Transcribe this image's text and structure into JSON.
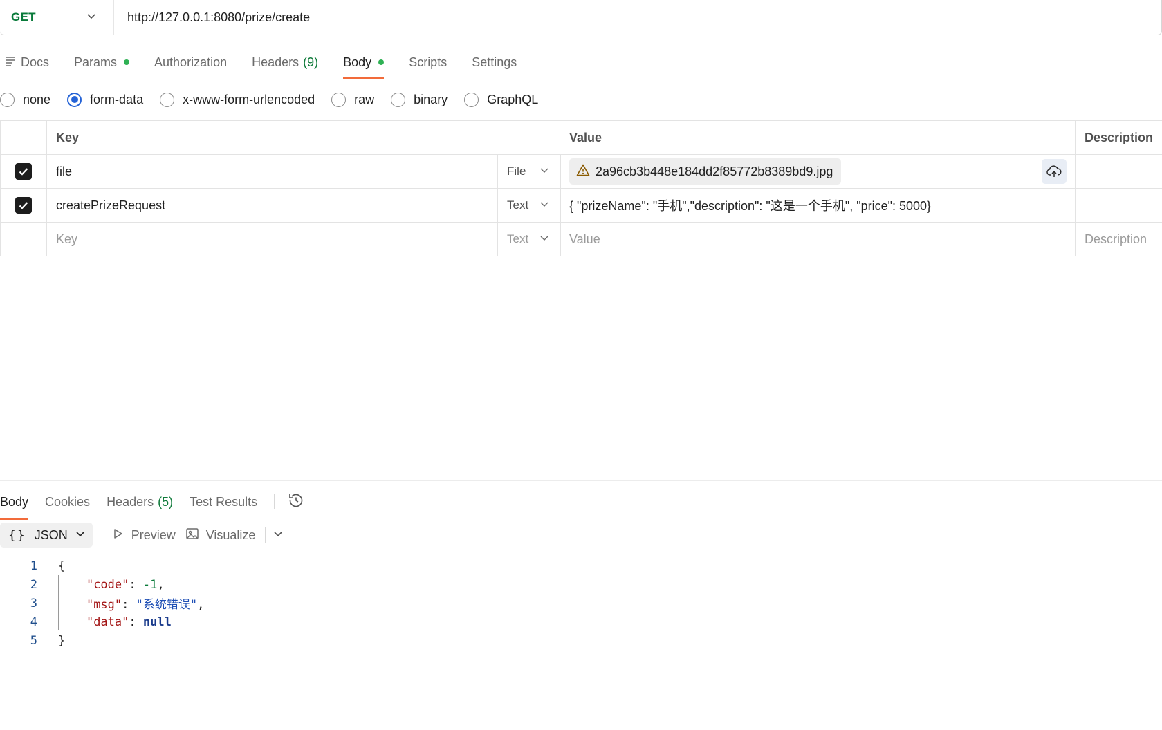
{
  "request": {
    "method": "GET",
    "url": "http://127.0.0.1:8080/prize/create"
  },
  "request_tabs": {
    "docs": "Docs",
    "params": "Params",
    "authorization": "Authorization",
    "headers": "Headers",
    "headers_count": "(9)",
    "body": "Body",
    "scripts": "Scripts",
    "settings": "Settings"
  },
  "body_types": {
    "none": "none",
    "form_data": "form-data",
    "urlencoded": "x-www-form-urlencoded",
    "raw": "raw",
    "binary": "binary",
    "graphql": "GraphQL",
    "selected": "form-data"
  },
  "form_table": {
    "headers": {
      "key": "Key",
      "value": "Value",
      "description": "Description"
    },
    "rows": [
      {
        "checked": true,
        "key": "file",
        "type": "File",
        "value": "2a96cb3b448e184dd2f85772b8389bd9.jpg"
      },
      {
        "checked": true,
        "key": "createPrizeRequest",
        "type": "Text",
        "value": "{ \"prizeName\": \"手机\",\"description\": \"这是一个手机\", \"price\": 5000}"
      }
    ],
    "new_row": {
      "key_placeholder": "Key",
      "type": "Text",
      "value_placeholder": "Value",
      "description_placeholder": "Description"
    }
  },
  "response_tabs": {
    "body": "Body",
    "cookies": "Cookies",
    "headers": "Headers",
    "headers_count": "(5)",
    "test_results": "Test Results"
  },
  "response_view": {
    "format": "JSON",
    "preview": "Preview",
    "visualize": "Visualize"
  },
  "response_body": {
    "line_numbers": [
      "1",
      "2",
      "3",
      "4",
      "5"
    ],
    "open_brace": "{",
    "close_brace": "}",
    "code_key": "\"code\"",
    "code_value": "-1",
    "msg_key": "\"msg\"",
    "msg_value": "\"系统错误\"",
    "data_key": "\"data\"",
    "data_value": "null"
  },
  "colors": {
    "method_green": "#097a3a",
    "accent_orange": "#f26b3a",
    "radio_blue": "#2563d6",
    "dot_green": "#2fb154"
  }
}
